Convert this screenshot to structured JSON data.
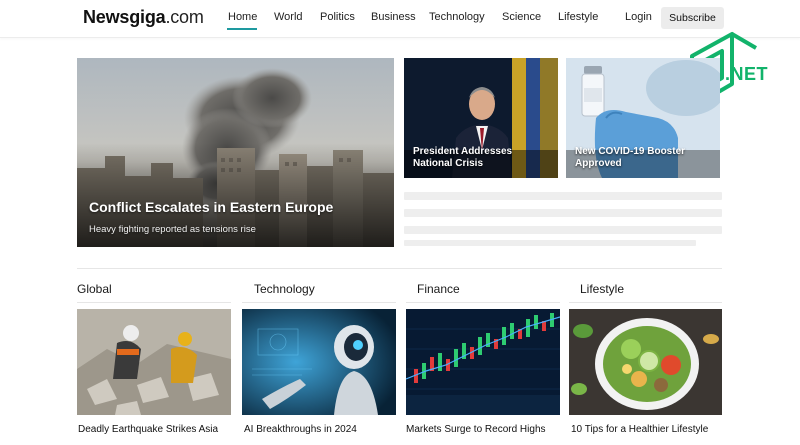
{
  "header": {
    "logo_brand": "Newsgiga",
    "logo_tld": ".com",
    "nav": [
      "Home",
      "World",
      "Politics",
      "Business",
      "Technology",
      "Science",
      "Lifestyle"
    ],
    "active_nav": "Home",
    "login": "Login",
    "subscribe": "Subscribe",
    "accent_color": "#1e9aa0"
  },
  "watermark": {
    "label": ".NET",
    "color": "#12b36b"
  },
  "hero": {
    "title": "Conflict Escalates in Eastern Europe",
    "subtitle": "Heavy fighting reported as tensions rise"
  },
  "side_cards": [
    {
      "title": "President Addresses National Crisis"
    },
    {
      "title": "New COVID-19 Booster Approved"
    }
  ],
  "categories": [
    {
      "name": "Global",
      "headline": "Deadly Earthquake Strikes Asia"
    },
    {
      "name": "Technology",
      "headline": "AI Breakthroughs in 2024"
    },
    {
      "name": "Finance",
      "headline": "Markets Surge to Record Highs"
    },
    {
      "name": "Lifestyle",
      "headline": "10 Tips for a Healthier Lifestyle"
    }
  ]
}
